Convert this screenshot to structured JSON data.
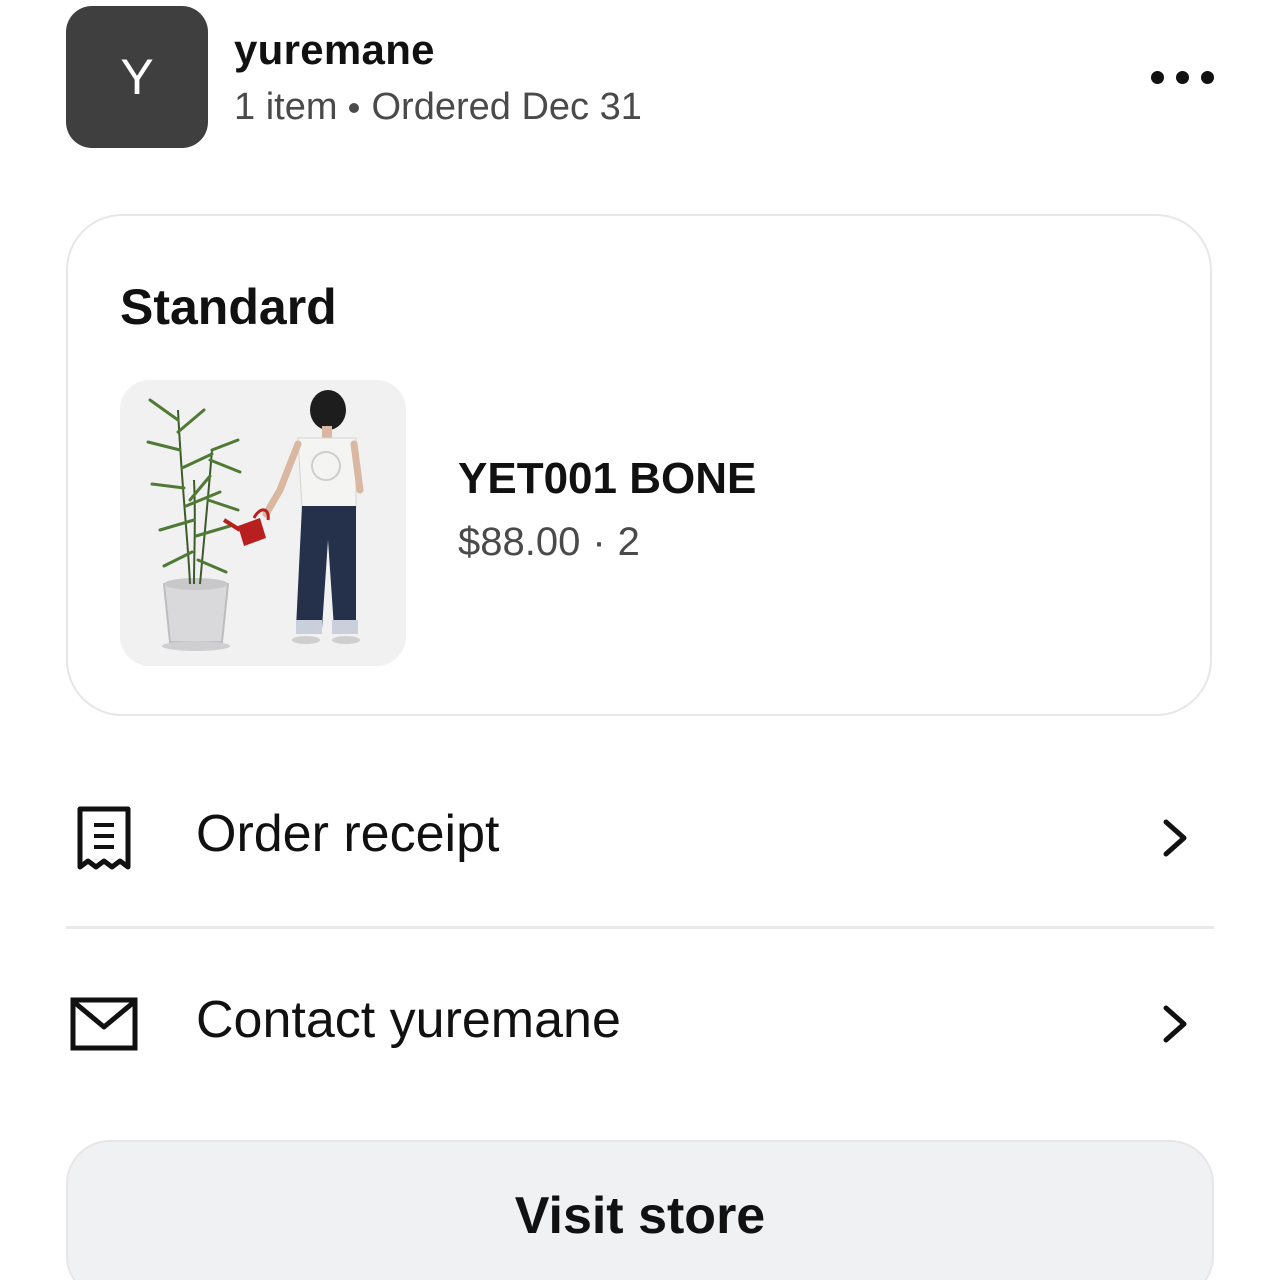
{
  "header": {
    "avatar_letter": "Y",
    "store_name": "yuremane",
    "item_count": "1 item",
    "ordered_date": "Ordered Dec 31",
    "more_icon": "more-horizontal-icon"
  },
  "shipment": {
    "title": "Standard",
    "product": {
      "name": "YET001 BONE",
      "price": "$88.00",
      "separator": "·",
      "quantity": "2"
    }
  },
  "actions": [
    {
      "label": "Order receipt",
      "icon": "receipt-icon"
    },
    {
      "label": "Contact yuremane",
      "icon": "envelope-icon"
    }
  ],
  "visit_store": {
    "label": "Visit store"
  },
  "colors": {
    "avatar_bg": "#3f3f3f",
    "text_primary": "#111111",
    "text_secondary": "#4a4a4a",
    "button_bg": "#f0f1f3",
    "divider": "#e9e9e9"
  }
}
